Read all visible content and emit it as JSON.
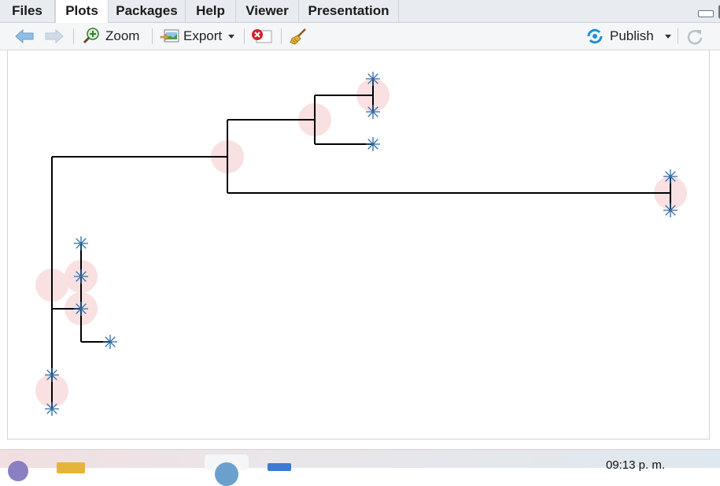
{
  "tabs": [
    {
      "label": "Files",
      "active": false
    },
    {
      "label": "Plots",
      "active": true
    },
    {
      "label": "Packages",
      "active": false
    },
    {
      "label": "Help",
      "active": false
    },
    {
      "label": "Viewer",
      "active": false
    },
    {
      "label": "Presentation",
      "active": false
    }
  ],
  "toolbar": {
    "back_icon": "arrow-left-icon",
    "forward_icon": "arrow-right-icon",
    "zoom_label": "Zoom",
    "export_label": "Export",
    "remove_icon": "remove-plot-icon",
    "clear_icon": "broom-icon",
    "publish_label": "Publish",
    "refresh_icon": "refresh-icon"
  },
  "colors": {
    "tree_line": "#000000",
    "node_marker": "#2e6aa8",
    "highlight_circle": "#f7d6d8",
    "accent_blue": "#1e90d6"
  },
  "taskbar": {
    "clock": "09:13 p. m."
  }
}
